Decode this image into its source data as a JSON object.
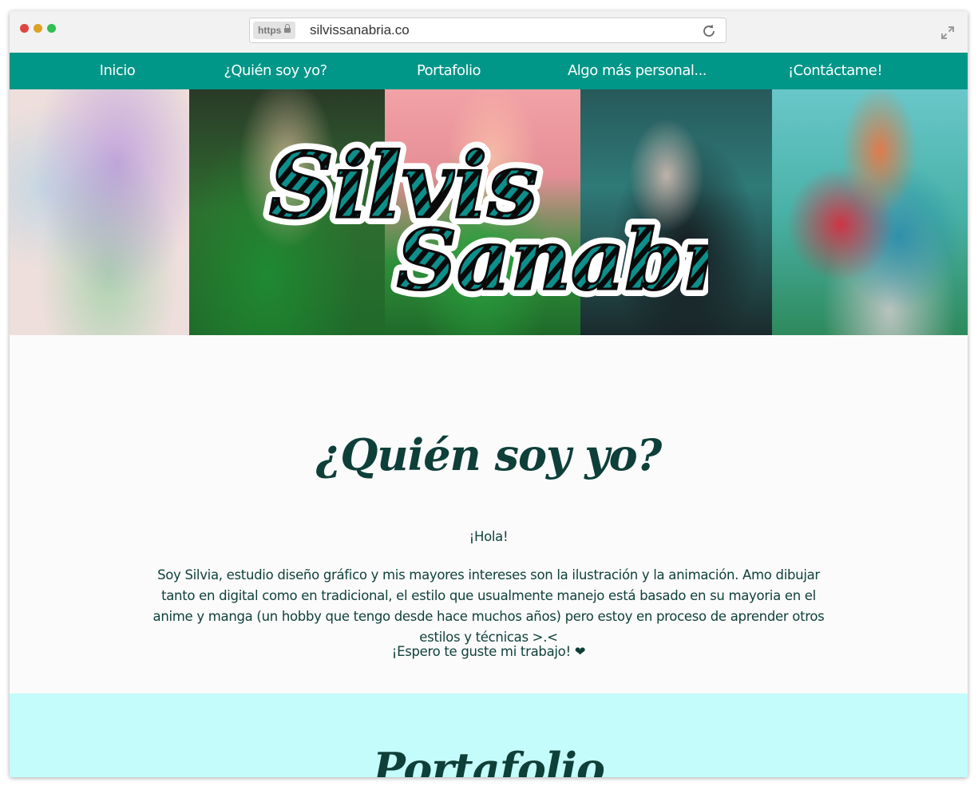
{
  "browser": {
    "https_label": "https",
    "url": "silvissanabria.co"
  },
  "nav": {
    "items": [
      {
        "label": "Inicio"
      },
      {
        "label": "¿Quién soy yo?"
      },
      {
        "label": "Portafolio"
      },
      {
        "label": "Algo más personal..."
      },
      {
        "label": "¡Contáctame!"
      }
    ]
  },
  "banner": {
    "logo_text": "Silvis Sanabria"
  },
  "about": {
    "title": "¿Quién soy yo?",
    "greeting": "¡Hola!",
    "body": "Soy Silvia, estudio diseño gráfico y mis mayores intereses son la ilustración y la animación. Amo dibujar tanto en digital como en tradicional, el estilo que usualmente manejo está basado en su mayoria en el anime y manga (un hobby que tengo desde hace muchos años) pero estoy en proceso de aprender otros estilos y técnicas >.<",
    "outro": "¡Espero te guste mi trabajo! ❤"
  },
  "portfolio": {
    "title": "Portafolio"
  },
  "colors": {
    "nav_bg": "#009688",
    "heading": "#0e3f39",
    "portfolio_bg": "#c4fcfb"
  },
  "icons": [
    "lock-icon",
    "reload-icon",
    "expand-icon"
  ]
}
